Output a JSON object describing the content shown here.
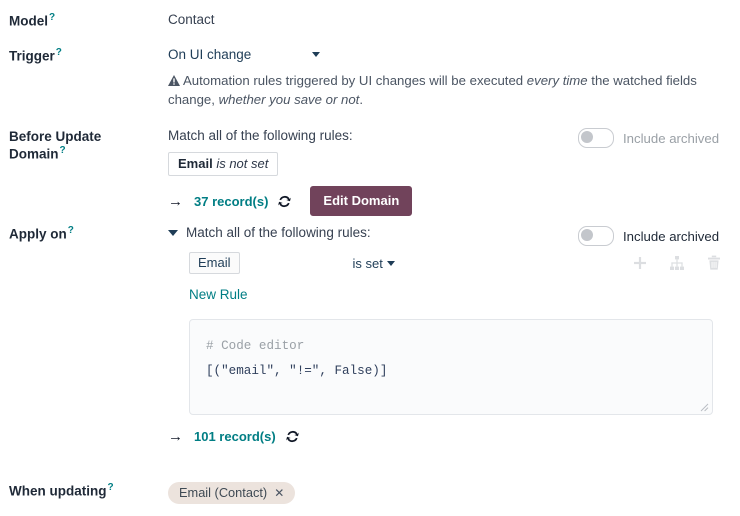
{
  "colors": {
    "primary": "#71435b",
    "link": "#017e84",
    "text": "#1f2937",
    "muted": "#9aa0a6",
    "tag_bg": "#ece3dd"
  },
  "fields": {
    "model": {
      "label": "Model",
      "help_marker": "?",
      "value": "Contact"
    },
    "trigger": {
      "label": "Trigger",
      "help_marker": "?",
      "value": "On UI change",
      "warning": {
        "icon": "warning-icon",
        "prefix": "Automation rules triggered by UI changes will be executed ",
        "emphasis1": "every time",
        "middle": " the watched fields change, ",
        "emphasis2": "whether you save or not",
        "suffix": "."
      }
    },
    "before_update_domain": {
      "label_line1": "Before Update",
      "label_line2": "Domain",
      "help_marker": "?",
      "match_text": "Match all of the following rules:",
      "facet": {
        "field": "Email",
        "operator": "is not set"
      },
      "arrow": "→",
      "records": "37 record(s)",
      "refresh_icon": "refresh-icon",
      "edit_button": "Edit Domain",
      "include_archived": {
        "label": "Include archived",
        "checked": false
      }
    },
    "apply_on": {
      "label": "Apply on",
      "help_marker": "?",
      "match_text": "Match all of the following rules:",
      "rule": {
        "field": "Email",
        "operator": "is set"
      },
      "row_icons": [
        "plus-icon",
        "branch-icon",
        "trash-icon"
      ],
      "new_rule_link": "New Rule",
      "code_editor": {
        "comment": "# Code editor",
        "code": "[(\"email\", \"!=\", False)]"
      },
      "arrow": "→",
      "records": "101 record(s)",
      "refresh_icon": "refresh-icon",
      "include_archived": {
        "label": "Include archived",
        "checked": false
      }
    },
    "when_updating": {
      "label": "When updating",
      "help_marker": "?",
      "tags": [
        {
          "text": "Email (Contact)",
          "remove": "✕"
        }
      ]
    }
  }
}
